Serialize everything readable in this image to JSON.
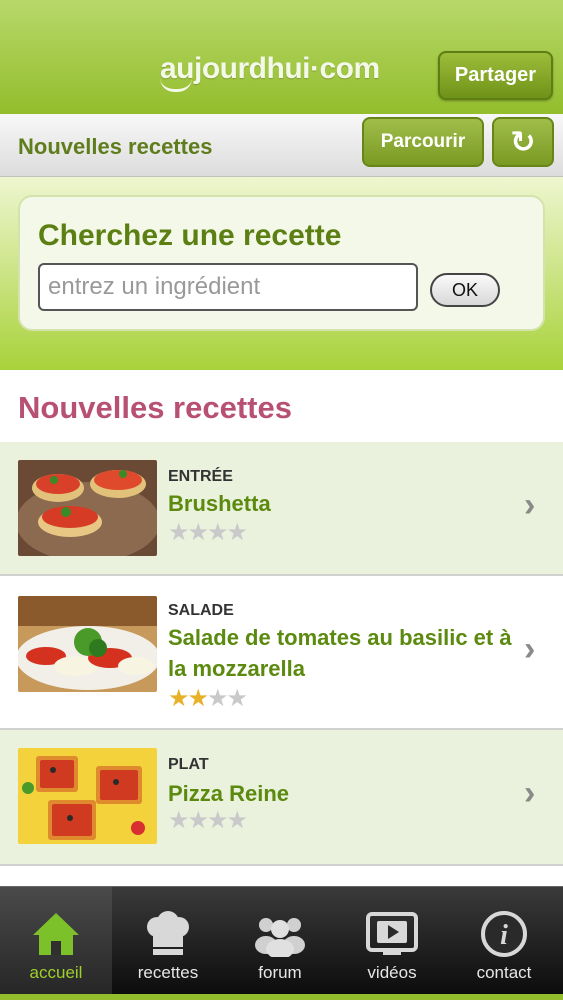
{
  "header": {
    "logo_text": "aujourdhui·com",
    "share_label": "Partager"
  },
  "subheader": {
    "title": "Nouvelles recettes",
    "browse_label": "Parcourir",
    "refresh_symbol": "↻"
  },
  "search": {
    "title": "Cherchez une recette",
    "placeholder": "entrez un ingrédient",
    "value": "",
    "ok_label": "OK"
  },
  "section": {
    "title": "Nouvelles recettes"
  },
  "recipes": [
    {
      "category": "ENTRÉE",
      "name": "Brushetta",
      "rating": 0,
      "max_rating": 4
    },
    {
      "category": "SALADE",
      "name": "Salade de tomates au basilic et à la mozzarella",
      "rating": 2,
      "max_rating": 4
    },
    {
      "category": "PLAT",
      "name": "Pizza Reine",
      "rating": 0,
      "max_rating": 4
    }
  ],
  "tabs": [
    {
      "label": "accueil",
      "icon": "home-icon",
      "active": true
    },
    {
      "label": "recettes",
      "icon": "chef-hat-icon",
      "active": false
    },
    {
      "label": "forum",
      "icon": "people-icon",
      "active": false
    },
    {
      "label": "vidéos",
      "icon": "video-icon",
      "active": false
    },
    {
      "label": "contact",
      "icon": "info-icon",
      "active": false
    }
  ],
  "colors": {
    "brand_green": "#93bd2c",
    "title_green": "#5b8a0f",
    "section_pink": "#b85074",
    "star_gold": "#e7b22a"
  }
}
